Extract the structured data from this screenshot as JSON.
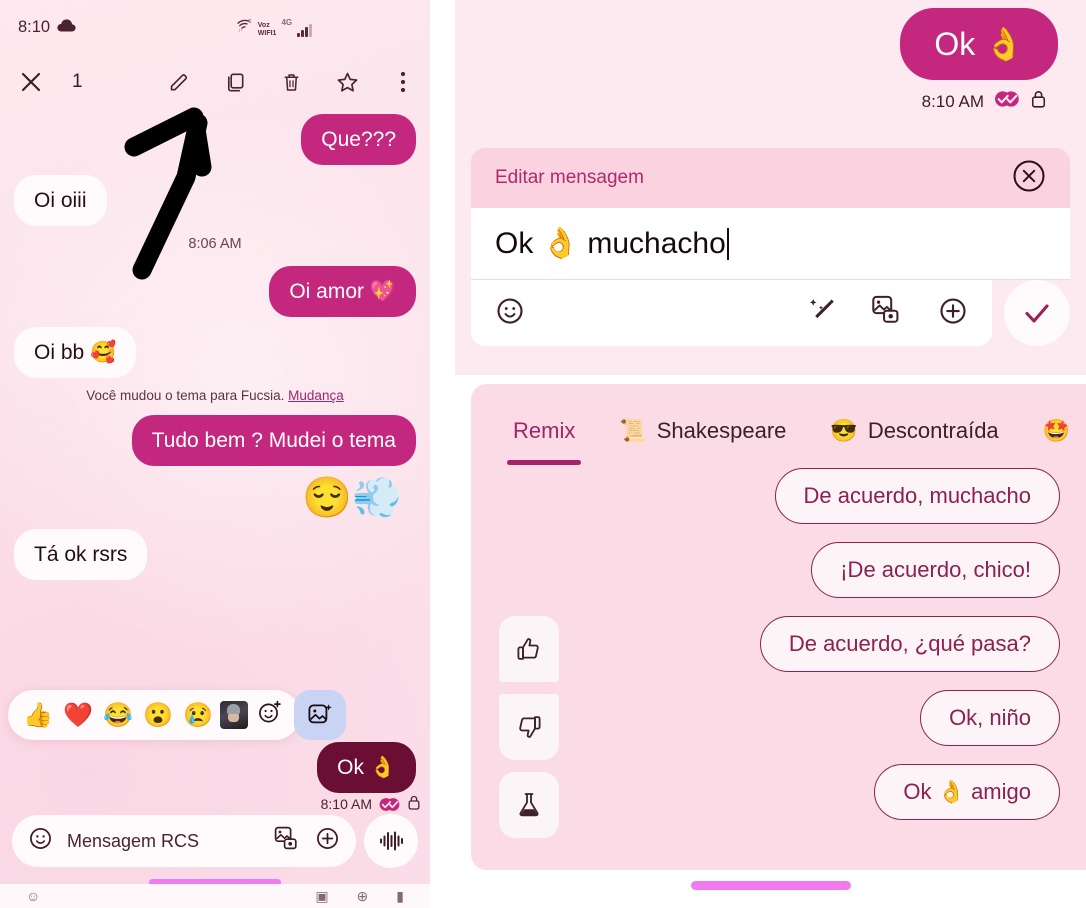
{
  "left": {
    "status_bar": {
      "time": "8:10",
      "cloud_icon": "cloud-icon",
      "wifi_label_1": "Voz",
      "wifi_label_2": "WIFI1",
      "network": "4G",
      "wifi_icon": "wifi-6-icon",
      "signal_icon": "signal-bars-icon"
    },
    "action_bar": {
      "close_icon": "close-icon",
      "selection_count": "1",
      "edit_icon": "pencil-edit-icon",
      "copy_icon": "copy-icon",
      "delete_icon": "trash-icon",
      "star_icon": "star-icon",
      "more_icon": "more-vertical-icon"
    },
    "messages": [
      {
        "id": "m1",
        "text": "Que???",
        "side": "out",
        "selected": false
      },
      {
        "id": "m2",
        "text": "Oi oiii",
        "side": "in",
        "selected": false
      },
      {
        "id": "m3",
        "text": "Oi amor 💖",
        "side": "out",
        "selected": false
      },
      {
        "id": "m4",
        "text": "Oi bb 🥰",
        "side": "in",
        "selected": false
      },
      {
        "id": "m5",
        "text": "Tudo bem ? Mudei o tema",
        "side": "out",
        "selected": false
      },
      {
        "id": "m6",
        "text": "Tá ok rsrs",
        "side": "in",
        "selected": false
      },
      {
        "id": "m7",
        "text": "Ok 👌",
        "side": "out",
        "selected": true
      }
    ],
    "timestamp_mid": "8:06 AM",
    "system_note": {
      "text": "Você mudou o tema para Fucsia.",
      "link": "Mudança"
    },
    "reaction_on_message": "😌💨",
    "selected_msg_meta": {
      "time": "8:10 AM",
      "read_icon": "double-check-read-icon",
      "lock_icon": "lock-icon"
    },
    "reaction_bar": {
      "emojis": [
        "👍",
        "❤️",
        "😂",
        "😮",
        "😢"
      ],
      "avatar_icon": "contact-avatar-reaction",
      "add_reaction_icon": "add-emoji-icon",
      "gallery_icon": "sticker-gallery-icon"
    },
    "composer": {
      "emoji_icon": "emoji-icon",
      "placeholder": "Mensagem RCS",
      "gallery_icon": "gallery-camera-icon",
      "plus_icon": "plus-circle-icon",
      "mic_icon": "voice-waveform-icon"
    },
    "annotation": {
      "arrow_icon": "hand-drawn-arrow-annotation"
    }
  },
  "right": {
    "top_message": {
      "text": "Ok 👌",
      "time": "8:10 AM",
      "read_icon": "double-check-read-icon",
      "lock_icon": "lock-icon"
    },
    "edit_card": {
      "title": "Editar mensagem",
      "close_icon": "close-circle-icon",
      "input_value": "Ok 👌 muchacho",
      "emoji_icon": "emoji-icon",
      "magic_icon": "magic-wand-icon",
      "gallery_icon": "gallery-camera-icon",
      "plus_icon": "plus-circle-icon",
      "confirm_icon": "check-confirm-icon"
    },
    "suggestions": {
      "tabs": [
        {
          "label": "Remix",
          "emoji": "",
          "active": true
        },
        {
          "label": "Shakespeare",
          "emoji": "📜",
          "active": false
        },
        {
          "label": "Descontraída",
          "emoji": "😎",
          "active": false
        },
        {
          "label": "",
          "emoji": "🤩",
          "active": false
        }
      ],
      "chips": [
        "De acuerdo, muchacho",
        "¡De acuerdo, chico!",
        "De acuerdo, ¿qué pasa?",
        "Ok, niño",
        "Ok 👌 amigo"
      ],
      "side_tools": {
        "thumbs_up_icon": "thumbs-up-icon",
        "thumbs_down_icon": "thumbs-down-icon",
        "lab_icon": "flask-lab-icon"
      }
    }
  },
  "colors": {
    "accent_fuchsia": "#c4277e",
    "selected_bubble": "#6b0e33",
    "panel_bg": "#fde9ef",
    "incoming_bubble": "#fffafc",
    "chip_border": "#8d2050",
    "home_indicator": "#f07bf0"
  }
}
